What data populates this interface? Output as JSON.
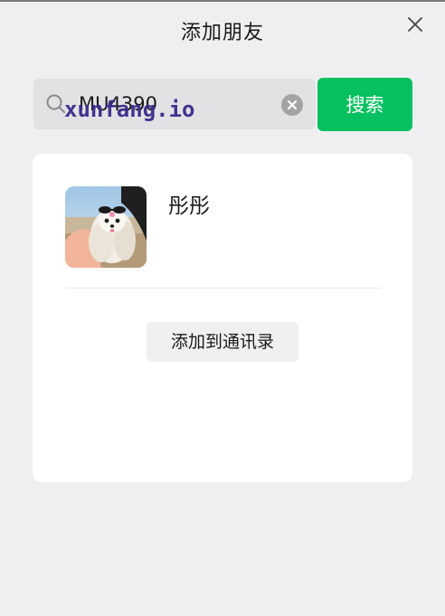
{
  "window": {
    "title": "添加朋友"
  },
  "search": {
    "value": "MU4390",
    "button_label": "搜索",
    "watermark": "xunfang.io"
  },
  "result": {
    "nickname": "彤彤",
    "add_button_label": "添加到通讯录"
  },
  "colors": {
    "accent": "#07c160",
    "background": "#efeff2",
    "card": "#ffffff"
  },
  "icons": {
    "close": "close-icon",
    "search": "search-icon",
    "clear": "clear-icon"
  }
}
